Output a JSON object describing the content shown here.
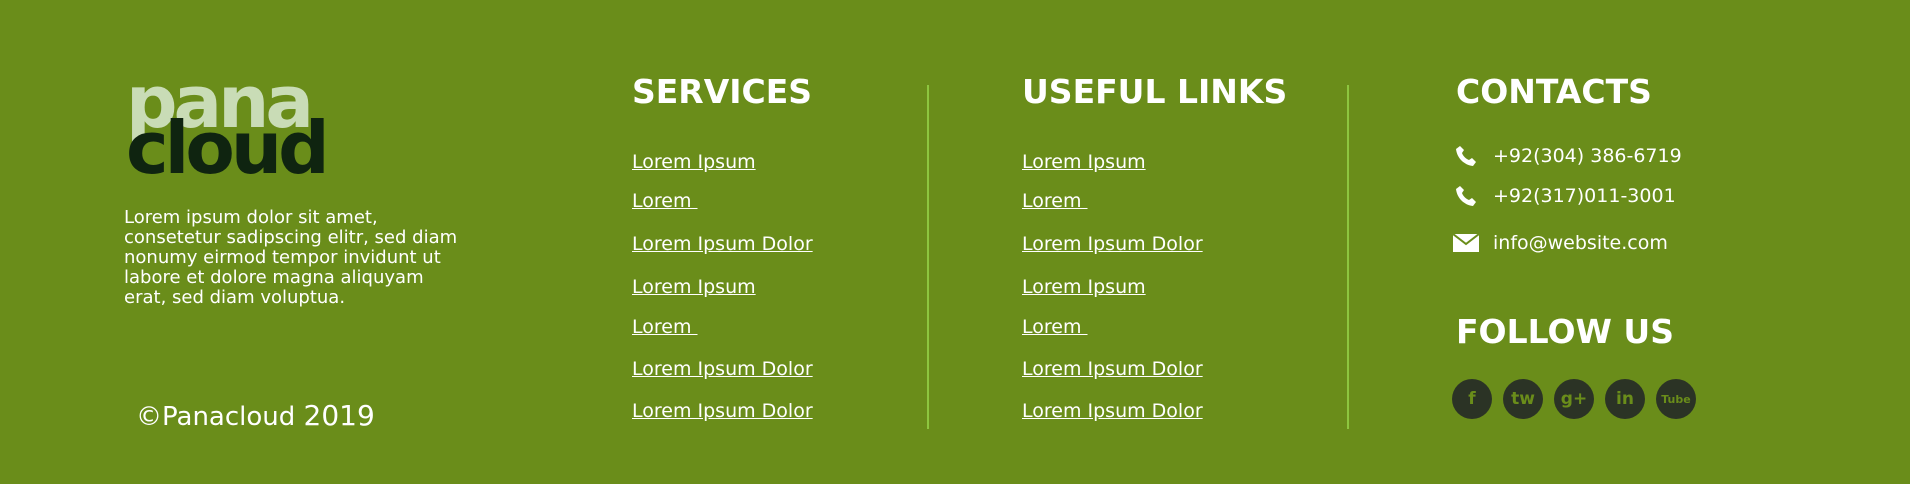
{
  "brand": {
    "logo_top": "pana",
    "logo_bottom": "cloud",
    "about": "Lorem ipsum dolor sit amet, consetetur sadipscing elitr, sed diam nonumy eirmod tempor invidunt ut labore et dolore magna aliquyam erat, sed diam voluptua.",
    "copyright": "©Panacloud",
    "year": "2019"
  },
  "services": {
    "title": "SERVICES",
    "items": [
      "Lorem Ipsum",
      "Lorem ",
      "Lorem Ipsum Dolor",
      "Lorem Ipsum",
      "Lorem ",
      "Lorem Ipsum Dolor",
      "Lorem Ipsum Dolor"
    ]
  },
  "useful_links": {
    "title": "USEFUL LINKS",
    "items": [
      "Lorem Ipsum",
      "Lorem ",
      "Lorem Ipsum Dolor",
      "Lorem Ipsum",
      "Lorem ",
      "Lorem Ipsum Dolor",
      "Lorem Ipsum Dolor"
    ]
  },
  "contacts": {
    "title": "CONTACTS",
    "phone1": "+92(304) 386-6719",
    "phone2": "+92(317)011-3001",
    "email": "info@website.com",
    "phone_icon": "phone-icon",
    "email_icon": "envelope-icon"
  },
  "follow": {
    "title": "FOLLOW US",
    "socials": [
      "f",
      "tw",
      "g+",
      "in",
      "Tube"
    ]
  },
  "colors": {
    "background": "#6a8d1a",
    "divider": "#8dc63f",
    "logo_light": "#c9dcb6",
    "logo_dark": "#0f2410",
    "social_bg": "#2b3325"
  }
}
